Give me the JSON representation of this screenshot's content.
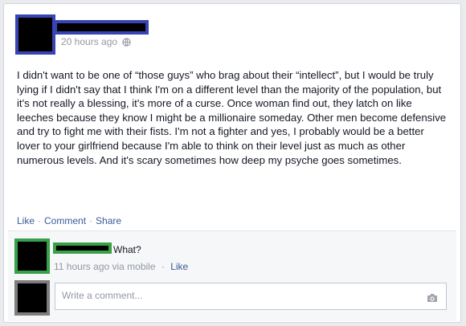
{
  "post": {
    "timestamp": "20 hours ago",
    "privacy_icon": "globe-icon",
    "body": "I didn't want to be one of “those guys” who brag about their “intellect”, but I would be truly lying if I didn't say that I think I'm on a different level than the majority of the population, but it's not really a blessing, it's more of a curse. Once woman find out, they latch on like leeches because they know I might be a millionaire someday. Other men become defensive and try to fight me with their fists. I'm not a fighter and yes, I probably would be a better lover to your girlfriend because I'm able to think on their level just as much as other numerous levels. And it's scary sometimes how deep my psyche goes sometimes.",
    "actions": {
      "like": "Like",
      "comment": "Comment",
      "share": "Share",
      "separator": "·"
    }
  },
  "comment": {
    "text": "What?",
    "meta": "11 hours ago via mobile",
    "separator": "·",
    "like": "Like"
  },
  "composer": {
    "placeholder": "Write a comment...",
    "camera_icon": "camera-icon"
  },
  "colors": {
    "poster_highlight": "#3844b4",
    "commenter_highlight": "#39a047",
    "viewer_highlight": "#7d7d7d",
    "link": "#3b5998"
  }
}
